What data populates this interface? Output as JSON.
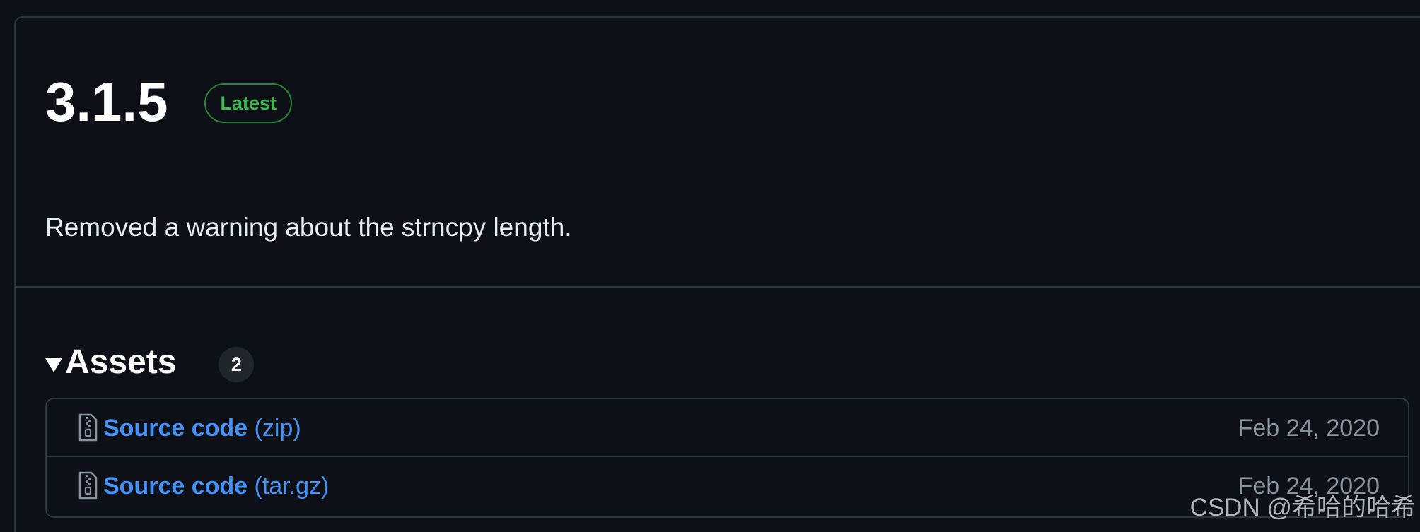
{
  "release": {
    "version": "3.1.5",
    "latest_badge": "Latest",
    "notes": "Removed a warning about the strncpy length."
  },
  "assets": {
    "title": "Assets",
    "count": "2",
    "items": [
      {
        "name": "Source code",
        "ext": "(zip)",
        "date": "Feb 24, 2020"
      },
      {
        "name": "Source code",
        "ext": "(tar.gz)",
        "date": "Feb 24, 2020"
      }
    ]
  },
  "watermark": "CSDN @希哈的哈希",
  "colors": {
    "background": "#0d1117",
    "border": "#30363d",
    "link": "#4493f8",
    "latest_green": "#3fb950",
    "muted": "#8b949e"
  },
  "icons": {
    "asset": "file-zip-icon",
    "caret": "triangle-down-icon"
  }
}
